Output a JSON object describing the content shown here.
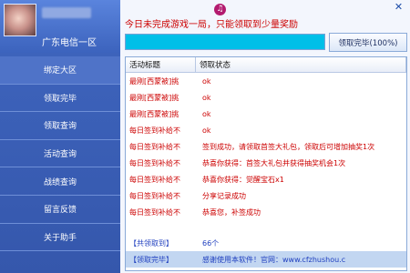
{
  "sidebar": {
    "username": "",
    "server": "广东电信一区",
    "items": [
      {
        "label": "绑定大区"
      },
      {
        "label": "领取完毕"
      },
      {
        "label": "领取查询"
      },
      {
        "label": "活动查询"
      },
      {
        "label": "战绩查询"
      },
      {
        "label": "留言反馈"
      },
      {
        "label": "关于助手"
      }
    ]
  },
  "main": {
    "notice": "今日未完成游戏一局，只能领取到少量奖励",
    "progress_percent": 100,
    "status_button": "领取完毕(100%)",
    "table": {
      "headers": [
        "活动标题",
        "领取状态"
      ],
      "rows": [
        {
          "title": "最刚[西蒙被]挑",
          "status": "ok"
        },
        {
          "title": "最刚[西蒙被]挑",
          "status": "ok"
        },
        {
          "title": "最刚[西蒙被]挑",
          "status": "ok"
        },
        {
          "title": "每日签到补给不",
          "status": "ok"
        },
        {
          "title": "每日签到补给不",
          "status": "签到成功，请领取首签大礼包，领取后可增加抽奖1次"
        },
        {
          "title": "每日签到补给不",
          "status": "恭喜你获得：首签大礼包并获得抽奖机会1次"
        },
        {
          "title": "每日签到补给不",
          "status": "恭喜你获得：觉醒宝石x1"
        },
        {
          "title": "每日签到补给不",
          "status": "分享记录成功"
        },
        {
          "title": "每日签到补给不",
          "status": "恭喜您，补签成功"
        }
      ],
      "total_label": "【共领取到】",
      "total_value": "66个",
      "footer_left": "【领取完毕】",
      "footer_right": "感谢使用本软件！官网：www.cfzhushou.c"
    }
  },
  "colors": {
    "sidebar_bg": "#3f66bf",
    "accent_red": "#cc0000",
    "accent_blue": "#1f3fbf",
    "progress_fill": "#00bfe8"
  }
}
